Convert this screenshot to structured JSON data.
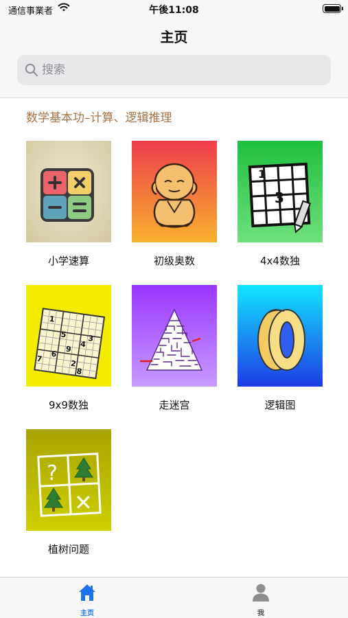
{
  "status_bar": {
    "carrier": "通信事業者",
    "time": "午後11:08"
  },
  "nav": {
    "title": "主页"
  },
  "search": {
    "placeholder": "搜索"
  },
  "section": {
    "title": "数学基本功–计算、逻辑推理"
  },
  "tiles": [
    {
      "label": "小学速算",
      "icon": "calculator-icon",
      "color": "#ddd5b4"
    },
    {
      "label": "初级奥数",
      "icon": "thinking-monk-icon",
      "color": "#f27a3a"
    },
    {
      "label": "4x4数独",
      "icon": "sudoku-4x4-icon",
      "color": "#39c95a"
    },
    {
      "label": "9x9数独",
      "icon": "sudoku-9x9-icon",
      "color": "#f2ec00"
    },
    {
      "label": "走迷宫",
      "icon": "maze-icon",
      "color": "#a44dff"
    },
    {
      "label": "逻辑图",
      "icon": "impossible-zero-icon",
      "color": "#1aa6f0"
    },
    {
      "label": "植树问题",
      "icon": "tree-grid-icon",
      "color": "#b8b700"
    }
  ],
  "sudoku4": {
    "digits": [
      "1",
      "3"
    ]
  },
  "sudoku9": {
    "digits": [
      "1",
      "5",
      "3",
      "4",
      "9",
      "6",
      "2",
      "7",
      "8"
    ]
  },
  "tree_grid": {
    "symbols": [
      "?",
      "✕"
    ]
  },
  "tab_bar": {
    "tabs": [
      {
        "label": "主页",
        "icon": "home-icon",
        "active": true,
        "color": "#1a73e8"
      },
      {
        "label": "我",
        "icon": "person-icon",
        "active": false,
        "color": "#8e8e8e"
      }
    ]
  }
}
